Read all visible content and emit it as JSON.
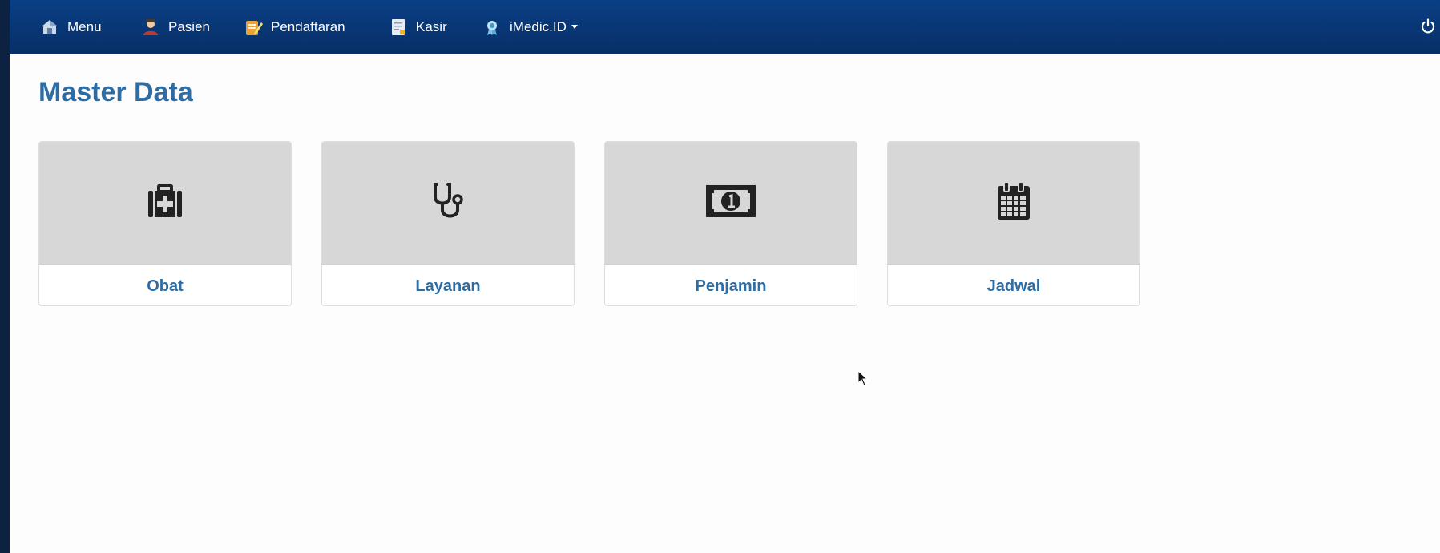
{
  "navbar": {
    "items": [
      {
        "label": "Menu",
        "icon": "home-icon"
      },
      {
        "label": "Pasien",
        "icon": "patient-icon"
      },
      {
        "label": "Pendaftaran",
        "icon": "registration-icon"
      },
      {
        "label": "Kasir",
        "icon": "cashier-icon"
      },
      {
        "label": "iMedic.ID",
        "icon": "imedic-icon",
        "dropdown": true
      }
    ],
    "power_icon": "power-icon",
    "background": "#0a3f86"
  },
  "page": {
    "title": "Master Data"
  },
  "cards": [
    {
      "label": "Obat",
      "icon": "medkit-icon"
    },
    {
      "label": "Layanan",
      "icon": "stethoscope-icon"
    },
    {
      "label": "Penjamin",
      "icon": "money-icon"
    },
    {
      "label": "Jadwal",
      "icon": "calendar-icon"
    }
  ],
  "colors": {
    "accent": "#2e6da4",
    "card_thumb": "#d7d7d7"
  }
}
